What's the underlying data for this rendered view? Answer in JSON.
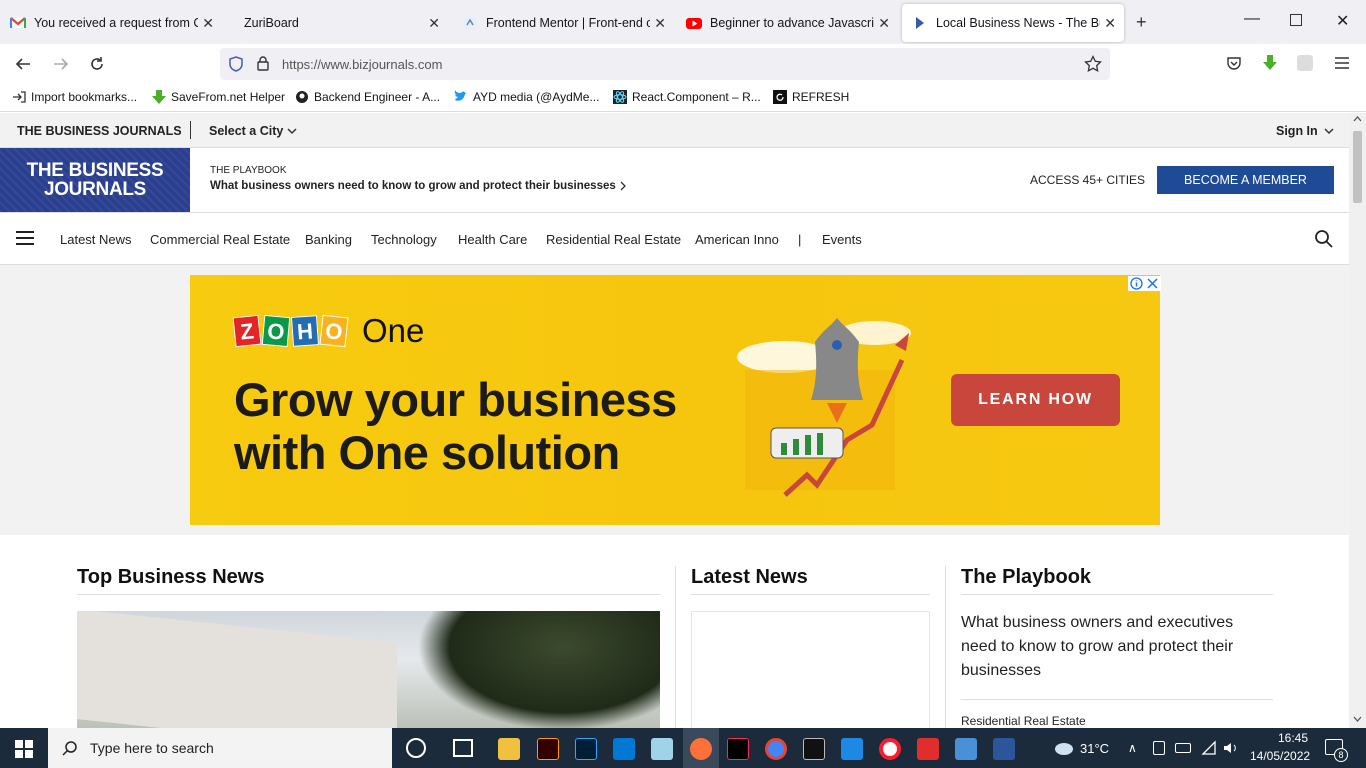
{
  "browser": {
    "tabs": [
      {
        "title": "You received a request from Co",
        "active": false
      },
      {
        "title": "ZuriBoard",
        "active": false
      },
      {
        "title": "Frontend Mentor | Front-end co",
        "active": false
      },
      {
        "title": "Beginner to advance Javascript",
        "active": false
      },
      {
        "title": "Local Business News - The Busir",
        "active": true
      }
    ],
    "url": "https://www.bizjournals.com",
    "bookmarks": [
      "Import bookmarks...",
      "SaveFrom.net Helper",
      "Backend Engineer - A...",
      "AYD media (@AydMe...",
      "React.Component – R...",
      "REFRESH"
    ]
  },
  "site": {
    "topbar": {
      "brand": "THE BUSINESS JOURNALS",
      "city_select": "Select a City",
      "sign_in": "Sign In"
    },
    "logo_line1": "THE BUSINESS",
    "logo_line2": "JOURNALS",
    "playbook_kicker": "THE PLAYBOOK",
    "playbook_text": "What business owners need to know to grow and protect their businesses",
    "access_cities": "ACCESS 45+ CITIES",
    "become_member": "BECOME A MEMBER",
    "menu": [
      "Latest News",
      "Commercial Real Estate",
      "Banking",
      "Technology",
      "Health Care",
      "Residential Real Estate",
      "American Inno",
      "|",
      "Events"
    ]
  },
  "ad": {
    "brand_letters": [
      "Z",
      "O",
      "H",
      "O"
    ],
    "brand_suffix": "One",
    "headline_line1": "Grow your business",
    "headline_line2": "with One solution",
    "cta": "LEARN HOW"
  },
  "content": {
    "top_business_news": "Top Business News",
    "latest_news": "Latest News",
    "playbook_title": "The Playbook",
    "playbook_desc": "What business owners and executives need to know to grow and protect their businesses",
    "playbook_category": "Residential Real Estate"
  },
  "taskbar": {
    "search_placeholder": "Type here to search",
    "weather": "31°C",
    "time": "16:45",
    "date": "14/05/2022",
    "notifications": "8"
  },
  "colors": {
    "brand_navy": "#2a3f8f",
    "member_button": "#1f4a96",
    "ad_yellow": "#f6c60e",
    "cta_red": "#c8463b"
  }
}
